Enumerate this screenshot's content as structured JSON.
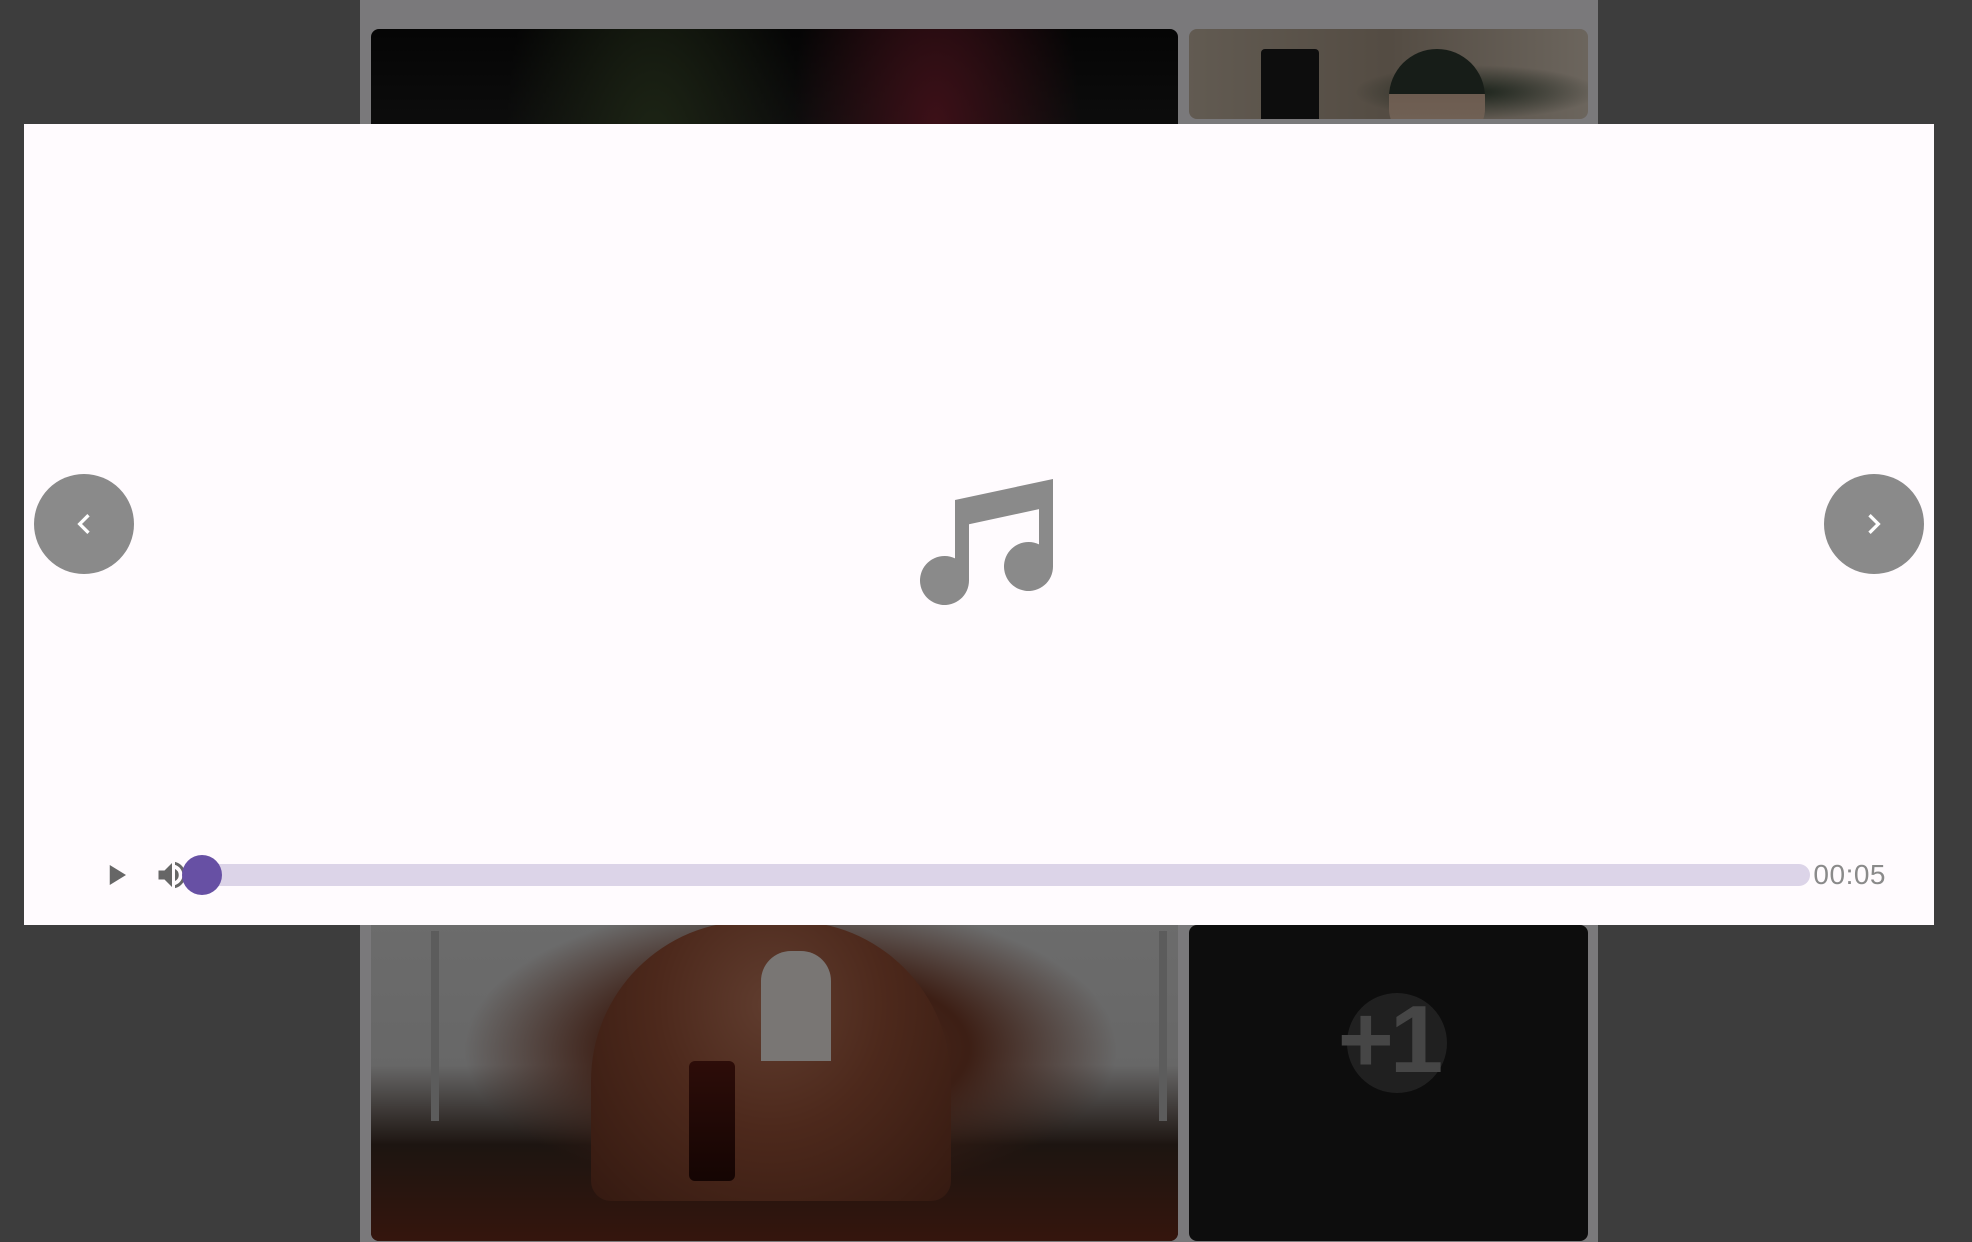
{
  "background_gallery": {
    "more_count_label": "+1"
  },
  "viewer": {
    "media_icon": "music-note-icon",
    "prev_icon": "chevron-left-icon",
    "next_icon": "chevron-right-icon",
    "controls": {
      "play_icon": "play-icon",
      "volume_icon": "volume-up-icon",
      "progress_fraction": 0.006,
      "time_label": "00:05"
    }
  },
  "colors": {
    "accent": "#6750a4",
    "track": "#dcd4e8",
    "viewer_bg": "#fffbfe",
    "icon_grey": "#8a8a8a"
  }
}
